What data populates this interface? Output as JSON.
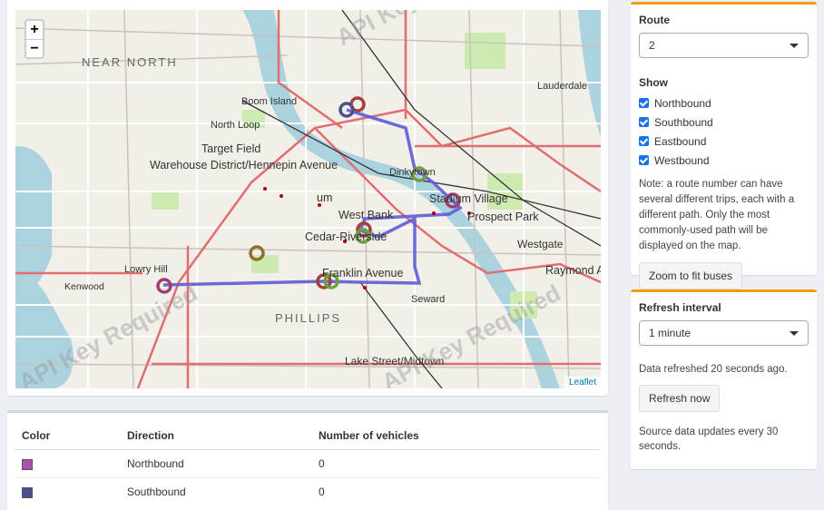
{
  "map": {
    "zoom_in_label": "+",
    "zoom_out_label": "−",
    "attribution": "Leaflet",
    "watermark": "API Key Required",
    "labels": [
      "NEAR NORTH",
      "Boom Island",
      "North Loop",
      "Target Field",
      "Warehouse District/Hennepin Avenue",
      "Lauderdale",
      "Dinkytown",
      "Stadium Village",
      "Prospect Park",
      "West Bank",
      "Cedar-Riverside",
      "Westgate",
      "Raymond A",
      "Lowry Hill",
      "Kenwood",
      "Franklin Avenue",
      "Seward",
      "PHILLIPS",
      "Lake Street/Midtown",
      "um"
    ],
    "colors": {
      "route_line": "#5c5cd6",
      "northbound": "#b04fb0",
      "southbound": "#4f4f8f",
      "eastbound": "#8f6f2f",
      "westbound": "#6f9f3f"
    }
  },
  "vehicle_table": {
    "headers": [
      "Color",
      "Direction",
      "Number of vehicles"
    ],
    "rows": [
      {
        "color": "#b04fb0",
        "direction": "Northbound",
        "count": "0"
      },
      {
        "color": "#4f4f8f",
        "direction": "Southbound",
        "count": "0"
      }
    ]
  },
  "route_panel": {
    "route_label": "Route",
    "route_value": "2",
    "show_label": "Show",
    "directions": [
      "Northbound",
      "Southbound",
      "Eastbound",
      "Westbound"
    ],
    "note": "Note: a route number can have several different trips, each with a different path. Only the most commonly-used path will be displayed on the map.",
    "zoom_button": "Zoom to fit buses"
  },
  "refresh_panel": {
    "title": "Refresh interval",
    "interval_value": "1 minute",
    "refreshed_text": "Data refreshed 20 seconds ago.",
    "refresh_button": "Refresh now",
    "source_note": "Source data updates every 30 seconds."
  }
}
